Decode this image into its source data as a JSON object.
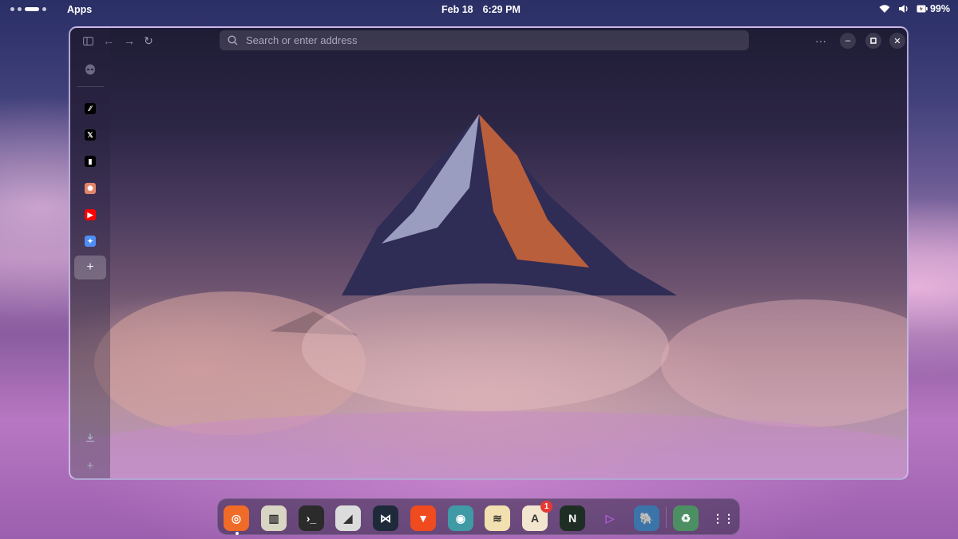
{
  "topbar": {
    "apps_label": "Apps",
    "date": "Feb 18",
    "time": "6:29 PM",
    "battery": "99%"
  },
  "browser": {
    "address_placeholder": "Search or enter address"
  },
  "sidebar": {
    "pinned": [
      {
        "name": "perplexity-icon",
        "color": "#000000"
      },
      {
        "name": "x-icon",
        "color": "#000000"
      },
      {
        "name": "notion-icon",
        "color": "#000000"
      },
      {
        "name": "claude-icon",
        "color": "#e2856a"
      },
      {
        "name": "youtube-icon",
        "color": "#ff0000"
      },
      {
        "name": "gemini-icon",
        "color": "#4f8df5"
      }
    ]
  },
  "dock": {
    "apps": [
      {
        "name": "zen-browser-icon",
        "color": "#f06a28"
      },
      {
        "name": "files-icon",
        "color": "#d9d5c4"
      },
      {
        "name": "terminal-icon",
        "color": "#2b2b2b"
      },
      {
        "name": "text-editor-icon",
        "color": "#dcdcdc"
      },
      {
        "name": "vscode-icon",
        "color": "#1e2a3a"
      },
      {
        "name": "brave-icon",
        "color": "#f04a1f"
      },
      {
        "name": "settings-icon",
        "color": "#3f9aa6"
      },
      {
        "name": "layers-icon",
        "color": "#f2e0b0"
      },
      {
        "name": "app-store-icon",
        "color": "#f2e6cf",
        "badge": "1"
      },
      {
        "name": "neovim-icon",
        "color": "#1f2e25"
      },
      {
        "name": "audio-player-icon",
        "color": "#ffffff"
      },
      {
        "name": "postgresql-icon",
        "color": "#3a74a8"
      },
      {
        "name": "trash-icon",
        "color": "#4c8f62"
      },
      {
        "name": "app-grid-icon",
        "color": "#ffffff"
      }
    ]
  }
}
